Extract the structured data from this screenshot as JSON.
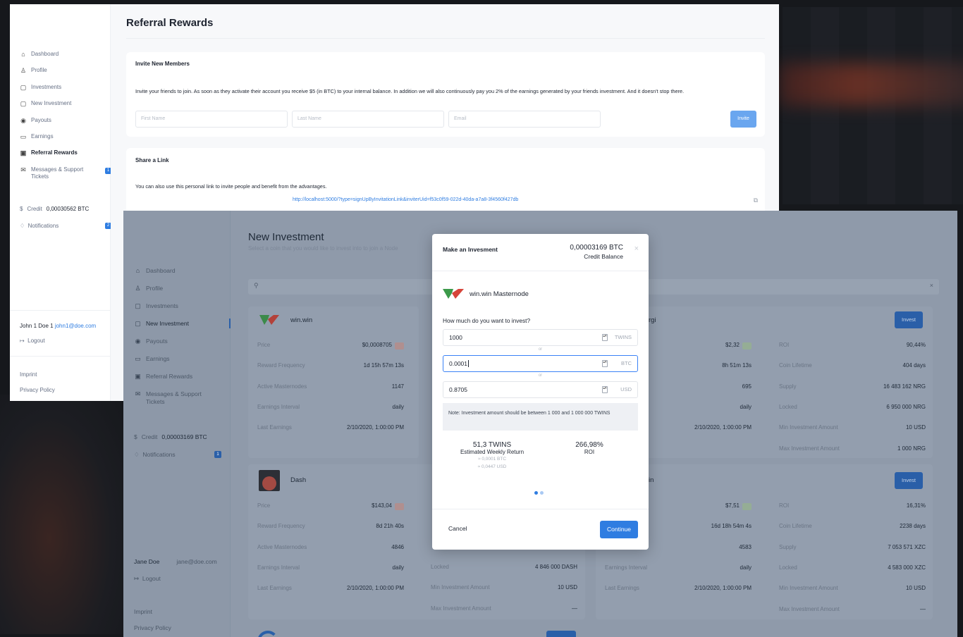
{
  "back_window": {
    "title": "Referral Rewards",
    "sidebar": {
      "items": [
        {
          "icon": "home-icon",
          "glyph": "⌂",
          "label": "Dashboard"
        },
        {
          "icon": "user-icon",
          "glyph": "♙",
          "label": "Profile"
        },
        {
          "icon": "file-icon",
          "glyph": "▢",
          "label": "Investments"
        },
        {
          "icon": "file-icon",
          "glyph": "▢",
          "label": "New Investment"
        },
        {
          "icon": "coins-icon",
          "glyph": "◉",
          "label": "Payouts"
        },
        {
          "icon": "wallet-icon",
          "glyph": "▭",
          "label": "Earnings"
        },
        {
          "icon": "gift-icon",
          "glyph": "▣",
          "label": "Referral Rewards"
        },
        {
          "icon": "mail-icon",
          "glyph": "✉",
          "label": "Messages & Support Tickets",
          "badge": "1"
        }
      ],
      "credit_label": "Credit",
      "credit_value": "0,00030562 BTC",
      "notifications_label": "Notifications",
      "notifications_badge": "2",
      "user_name": "John 1 Doe 1",
      "user_email": "john1@doe.com",
      "logout": "Logout",
      "imprint": "Imprint",
      "privacy": "Privacy Policy"
    },
    "invite": {
      "heading": "Invite New Members",
      "text": "Invite your friends to join. As soon as they activate their account you receive $5 (in BTC) to your internal balance. In addition we will also continuously pay you 2% of the earnings generated by your friends investment. And it doesn't stop there.",
      "first_name_placeholder": "First Name",
      "last_name_placeholder": "Last Name",
      "email_placeholder": "Email",
      "button": "Invite"
    },
    "share": {
      "heading": "Share a Link",
      "text": "You can also use this personal link to invite people and benefit from the advantages.",
      "link": "http://localhost:5000/?type=signUpByInvitationLink&inviterUid=f53c0f59-022d-40da-a7a8-3f4560f427db"
    }
  },
  "front_window": {
    "title": "New Investment",
    "subtitle": "Select a coin that you would like to invest into to join a Node",
    "sidebar": {
      "items": [
        {
          "icon": "home-icon",
          "glyph": "⌂",
          "label": "Dashboard"
        },
        {
          "icon": "user-icon",
          "glyph": "♙",
          "label": "Profile"
        },
        {
          "icon": "file-icon",
          "glyph": "▢",
          "label": "Investments"
        },
        {
          "icon": "file-icon",
          "glyph": "▢",
          "label": "New Investment"
        },
        {
          "icon": "coins-icon",
          "glyph": "◉",
          "label": "Payouts"
        },
        {
          "icon": "wallet-icon",
          "glyph": "▭",
          "label": "Earnings"
        },
        {
          "icon": "gift-icon",
          "glyph": "▣",
          "label": "Referral Rewards"
        },
        {
          "icon": "mail-icon",
          "glyph": "✉",
          "label": "Messages & Support Tickets"
        }
      ],
      "credit_label": "Credit",
      "credit_value": "0,00003169 BTC",
      "notifications_label": "Notifications",
      "notifications_badge": "1",
      "user_name": "Jane Doe",
      "user_email": "jane@doe.com",
      "logout": "Logout",
      "imprint": "Imprint",
      "privacy": "Privacy Policy"
    },
    "coins": {
      "winwin": {
        "name": "win.win",
        "rows": [
          {
            "k": "Price",
            "v": "$0,0008705",
            "pill": "-"
          },
          {
            "k": "Reward Frequency",
            "v": "1d 15h 57m 13s"
          },
          {
            "k": "Active Masternodes",
            "v": "1147"
          },
          {
            "k": "Earnings Interval",
            "v": "daily"
          },
          {
            "k": "Last Earnings",
            "v": "2/10/2020, 1:00:00 PM"
          }
        ]
      },
      "energi": {
        "name_suffix": "rgi",
        "button": "Invest",
        "rows_left": [
          {
            "k": "",
            "v": "$2,32",
            "pill": "+"
          },
          {
            "k": "cy",
            "v": "8h 51m 13s"
          },
          {
            "k": "des",
            "v": "695"
          },
          {
            "k": "l",
            "v": "daily"
          },
          {
            "k": "",
            "v": "2/10/2020, 1:00:00 PM"
          }
        ],
        "rows_right": [
          {
            "k": "ROI",
            "v": "90,44%"
          },
          {
            "k": "Coin Lifetime",
            "v": "404 days"
          },
          {
            "k": "Supply",
            "v": "16 483 162 NRG"
          },
          {
            "k": "Locked",
            "v": "6 950 000 NRG"
          },
          {
            "k": "Min Investment Amount",
            "v": "10 USD"
          },
          {
            "k": "Max Investment Amount",
            "v": "1 000 NRG"
          }
        ]
      },
      "dash": {
        "name": "Dash",
        "rows": [
          {
            "k": "Price",
            "v": "$143,04",
            "pill": "-"
          },
          {
            "k": "Reward Frequency",
            "v": "8d 21h 40s"
          },
          {
            "k": "Active Masternodes",
            "v": "4846"
          },
          {
            "k": "Earnings Interval",
            "v": "daily"
          },
          {
            "k": "Last Earnings",
            "v": "2/10/2020, 1:00:00 PM"
          }
        ],
        "rows_mid": [
          {
            "k": "Locked",
            "v": "4 846 000 DASH"
          },
          {
            "k": "Min Investment Amount",
            "v": "10 USD"
          },
          {
            "k": "Max Investment Amount",
            "v": "—"
          }
        ]
      },
      "pivx": {
        "name_suffix": "in",
        "button": "Invest",
        "rows_left": [
          {
            "k": "",
            "v": "$7,51",
            "pill": "+"
          },
          {
            "k": "cy",
            "v": "16d 18h 54m 4s"
          },
          {
            "k": "des",
            "v": "4583"
          },
          {
            "k": "Earnings Interval",
            "v": "daily"
          },
          {
            "k": "Last Earnings",
            "v": "2/10/2020, 1:00:00 PM"
          }
        ],
        "rows_right": [
          {
            "k": "ROI",
            "v": "16,31%"
          },
          {
            "k": "Coin Lifetime",
            "v": "2238 days"
          },
          {
            "k": "Supply",
            "v": "7 053 571 XZC"
          },
          {
            "k": "Locked",
            "v": "4 583 000 XZC"
          },
          {
            "k": "Min Investment Amount",
            "v": "10 USD"
          },
          {
            "k": "Max Investment Amount",
            "v": "—"
          }
        ]
      }
    }
  },
  "modal": {
    "title": "Make an Invesment",
    "balance_value": "0,00003169 BTC",
    "balance_label": "Credit Balance",
    "coin_name": "win.win Masternode",
    "question": "How much do you want to invest?",
    "amount_twins": "1000",
    "unit_twins": "TWINS",
    "or": "or",
    "amount_btc": "0.0001",
    "unit_btc": "BTC",
    "amount_usd": "0.8705",
    "unit_usd": "USD",
    "note": "Note: Investment amount should be between 1 000 and 1 000 000 TWINS",
    "weekly_return_value": "51,3 TWINS",
    "weekly_return_label": "Estimated Weekly Return",
    "weekly_btc": "≈ 0,0001 BTC",
    "weekly_usd": "≈ 0,0447 USD",
    "roi_value": "266,98%",
    "roi_label": "ROI",
    "cancel": "Cancel",
    "continue": "Continue"
  }
}
